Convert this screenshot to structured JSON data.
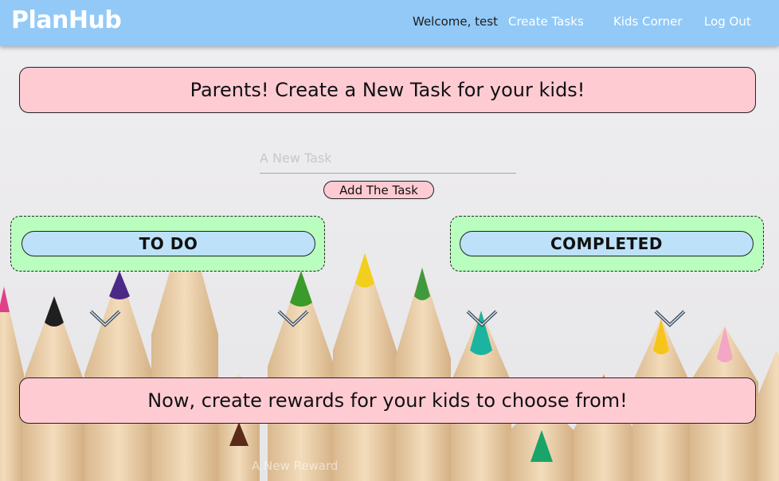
{
  "navbar": {
    "brand": "PlanHub",
    "welcome": "Welcome, test",
    "links": [
      "Create Tasks",
      "Kids Corner",
      "Log Out"
    ]
  },
  "create_banner": "Parents! Create a New Task for your kids!",
  "task_form": {
    "placeholder": "A New Task",
    "button_label": "Add The Task"
  },
  "columns": {
    "todo": "TO DO",
    "completed": "COMPLETED"
  },
  "rewards_banner": "Now, create rewards for your kids to choose from!",
  "reward_form": {
    "placeholder": "A New Reward"
  },
  "colors": {
    "navbar": "#92c9f7",
    "banner": "#fecbd3",
    "column": "#b9fdbf",
    "column_header": "#bde1f8"
  },
  "icons": [
    "chevron-down-icon",
    "chevron-down-icon",
    "chevron-down-icon",
    "chevron-down-icon"
  ]
}
